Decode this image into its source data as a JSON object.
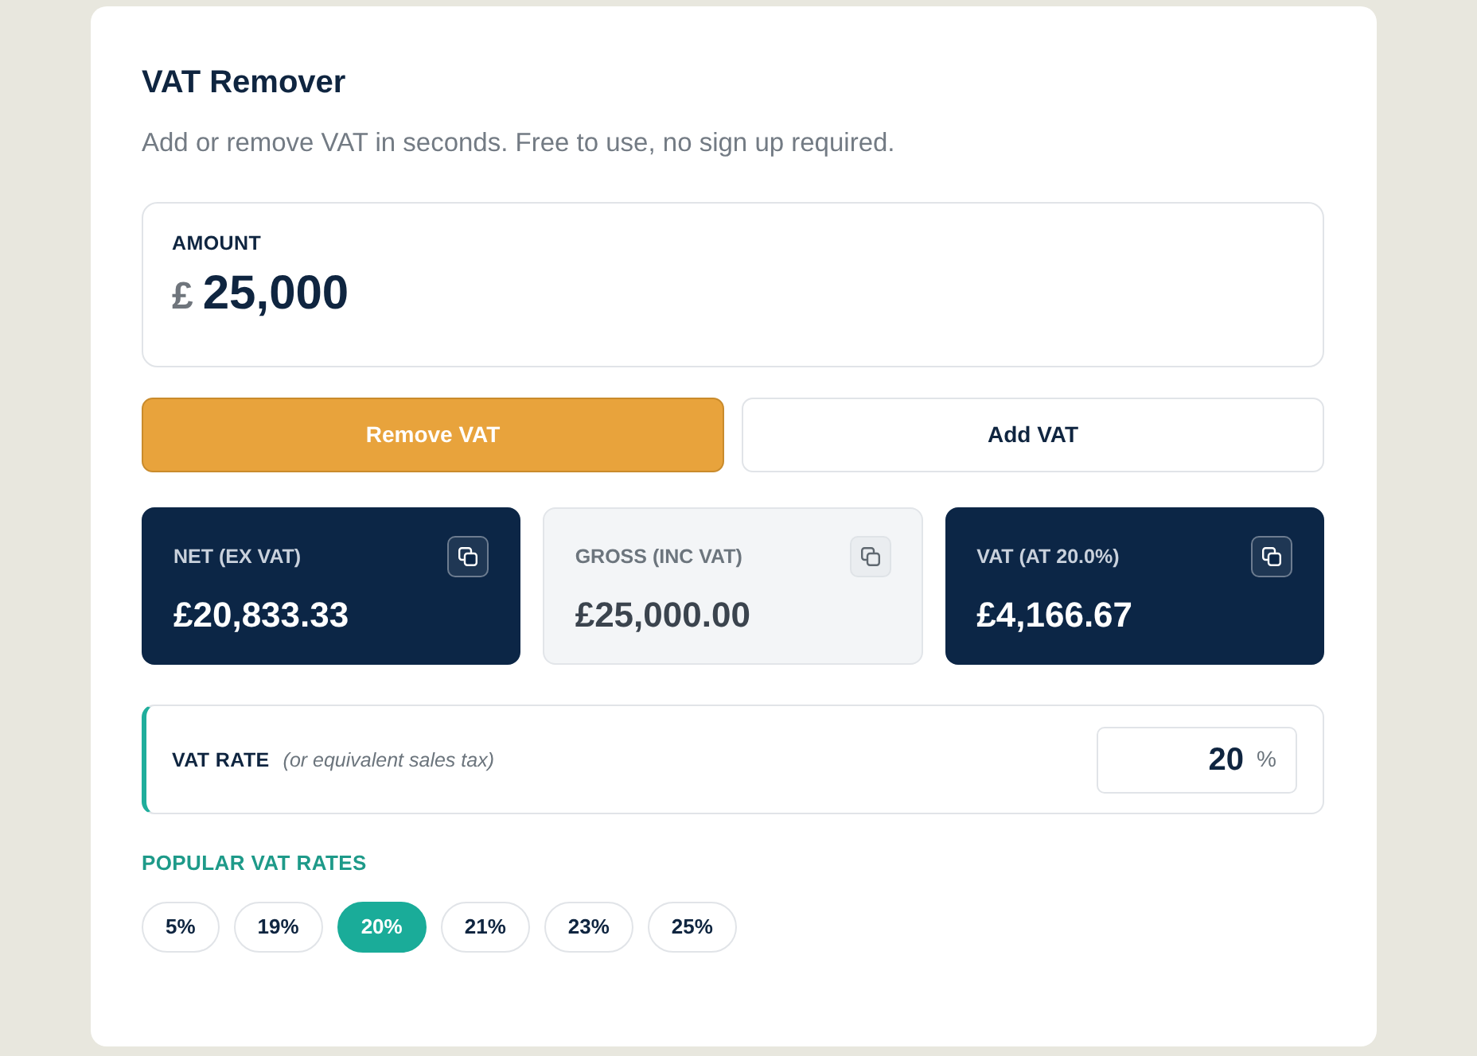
{
  "title": "VAT Remover",
  "subtitle": "Add or remove VAT in seconds. Free to use, no sign up required.",
  "amount": {
    "label": "AMOUNT",
    "currency": "£",
    "value": "25,000"
  },
  "mode_buttons": [
    {
      "label": "Remove VAT",
      "selected": true
    },
    {
      "label": "Add VAT",
      "selected": false
    }
  ],
  "results": [
    {
      "label": "NET (EX VAT)",
      "value": "£20,833.33",
      "highlighted": true
    },
    {
      "label": "GROSS (INC VAT)",
      "value": "£25,000.00",
      "highlighted": false
    },
    {
      "label": "VAT (AT 20.0%)",
      "value": "£4,166.67",
      "highlighted": true
    }
  ],
  "vat_rate": {
    "label": "VAT RATE",
    "note": "(or equivalent sales tax)",
    "value": "20",
    "unit": "%"
  },
  "popular_rates": {
    "heading": "POPULAR VAT RATES",
    "items": [
      {
        "label": "5%",
        "selected": false
      },
      {
        "label": "19%",
        "selected": false
      },
      {
        "label": "20%",
        "selected": true
      },
      {
        "label": "21%",
        "selected": false
      },
      {
        "label": "23%",
        "selected": false
      },
      {
        "label": "25%",
        "selected": false
      }
    ]
  }
}
